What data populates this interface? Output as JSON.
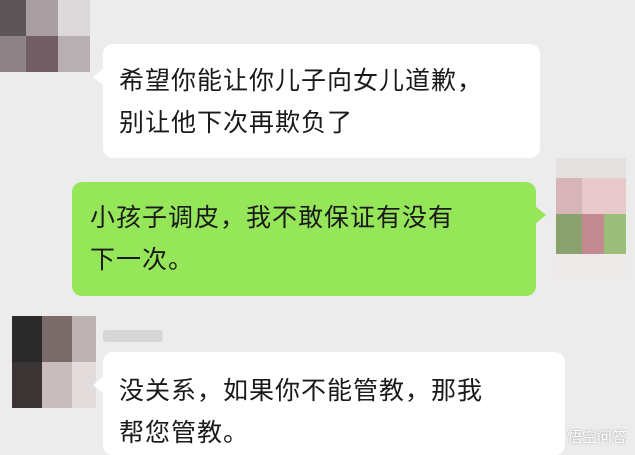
{
  "chat": {
    "messages": [
      {
        "side": "left",
        "line1": "希望你能让你儿子向女儿道歉，",
        "line2": "别让他下次再欺负了"
      },
      {
        "side": "right",
        "line1": "小孩子调皮，我不敢保证有没有",
        "line2": "下一次。"
      },
      {
        "side": "left",
        "line1": "没关系，如果你不能管教，那我",
        "line2": "帮您管教。"
      }
    ]
  },
  "watermark": {
    "text": "悟空问答"
  },
  "colors": {
    "background": "#ececec",
    "incoming_bubble": "#ffffff",
    "outgoing_bubble": "#96e65a"
  }
}
